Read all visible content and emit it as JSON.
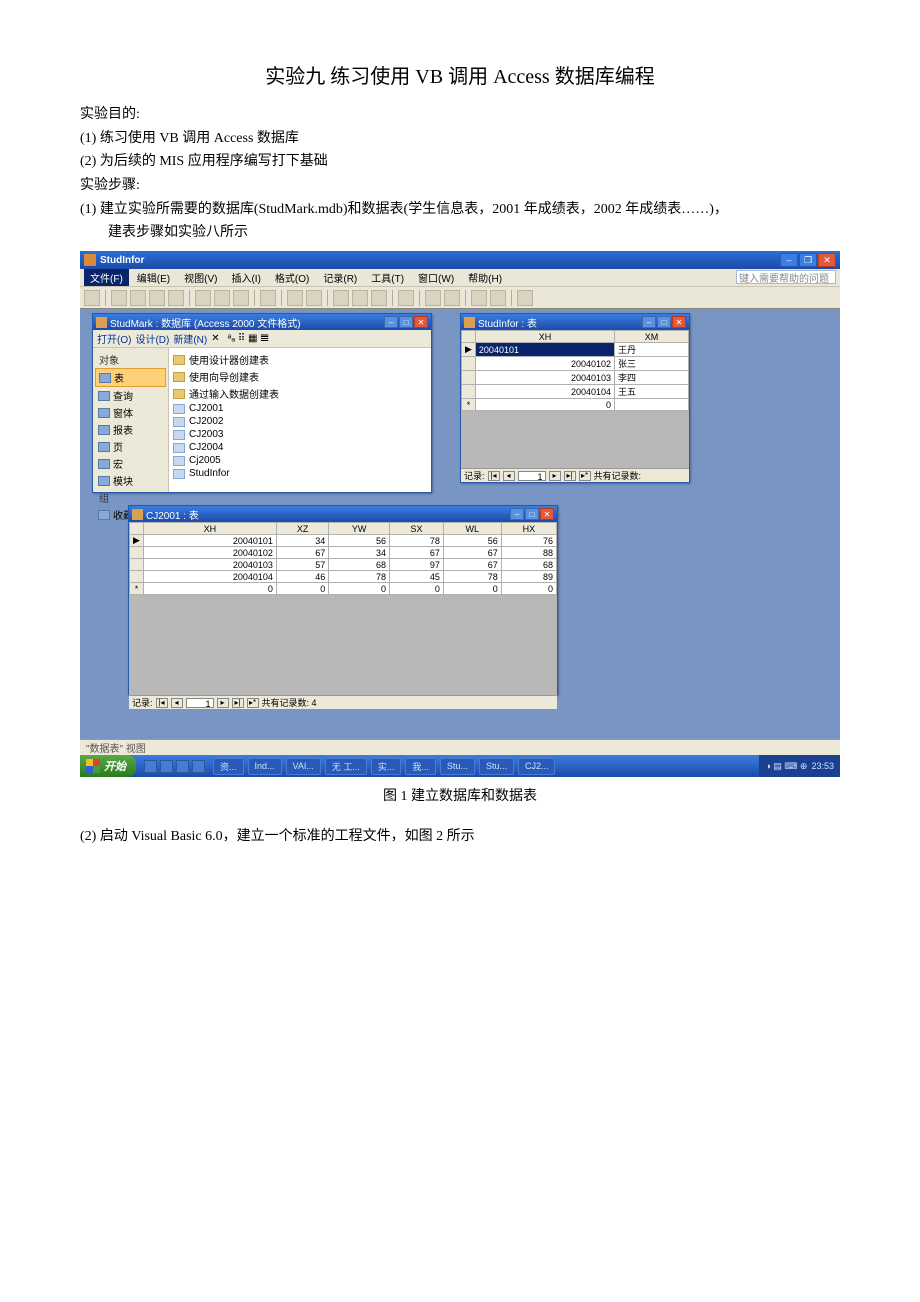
{
  "doc": {
    "title": "实验九 练习使用 VB 调用 Access 数据库编程",
    "purpose_label": "实验目的:",
    "purpose_items": [
      "(1) 练习使用 VB 调用 Access 数据库",
      "(2) 为后续的 MIS 应用程序编写打下基础"
    ],
    "steps_label": "实验步骤:",
    "step1": "(1) 建立实验所需要的数据库(StudMark.mdb)和数据表(学生信息表，2001 年成绩表，2002 年成绩表……)，",
    "step1b": "建表步骤如实验八所示",
    "fig1_caption": "图 1 建立数据库和数据表",
    "step2": "(2) 启动 Visual Basic 6.0，建立一个标准的工程文件，如图 2 所示"
  },
  "app": {
    "title": "StudInfor",
    "help_placeholder": "键入需要帮助的问题",
    "menus": [
      "文件(F)",
      "编辑(E)",
      "视图(V)",
      "插入(I)",
      "格式(O)",
      "记录(R)",
      "工具(T)",
      "窗口(W)",
      "帮助(H)"
    ],
    "status": "\"数据表\" 视图",
    "taskbar": {
      "start": "开始",
      "buttons": [
        "资...",
        "Ind...",
        "VAI...",
        "无 工...",
        "实...",
        "我...",
        "Stu...",
        "Stu...",
        "CJ2..."
      ],
      "clock": "23:53"
    }
  },
  "dbwin": {
    "title": "StudMark : 数据库 (Access 2000 文件格式)",
    "toolbar": [
      "打开(O)",
      "设计(D)",
      "新建(N)",
      "✕"
    ],
    "side_header": "对象",
    "side": [
      "表",
      "查询",
      "窗体",
      "报表",
      "页",
      "宏",
      "模块"
    ],
    "side2_header": "组",
    "side2": [
      "收藏夹"
    ],
    "main_create": [
      "使用设计器创建表",
      "使用向导创建表",
      "通过输入数据创建表"
    ],
    "main_tables": [
      "CJ2001",
      "CJ2002",
      "CJ2003",
      "CJ2004",
      "Cj2005",
      "StudInfor"
    ]
  },
  "studwin": {
    "title": "StudInfor : 表",
    "cols": [
      "XH",
      "XM"
    ],
    "rows": [
      [
        "20040101",
        "王丹"
      ],
      [
        "20040102",
        "张三"
      ],
      [
        "20040103",
        "李四"
      ],
      [
        "20040104",
        "王五"
      ]
    ],
    "newrow": [
      "0",
      ""
    ],
    "rec_label": "记录:",
    "rec_pos": "1",
    "rec_total": "共有记录数:"
  },
  "cjwin": {
    "title": "CJ2001 : 表",
    "cols": [
      "XH",
      "XZ",
      "YW",
      "SX",
      "WL",
      "HX"
    ],
    "rows": [
      [
        "20040101",
        "34",
        "56",
        "78",
        "56",
        "76"
      ],
      [
        "20040102",
        "67",
        "34",
        "67",
        "67",
        "88"
      ],
      [
        "20040103",
        "57",
        "68",
        "97",
        "67",
        "68"
      ],
      [
        "20040104",
        "46",
        "78",
        "45",
        "78",
        "89"
      ]
    ],
    "newrow": [
      "0",
      "0",
      "0",
      "0",
      "0",
      "0"
    ],
    "rec_label": "记录:",
    "rec_pos": "1",
    "rec_total": "共有记录数: 4"
  }
}
